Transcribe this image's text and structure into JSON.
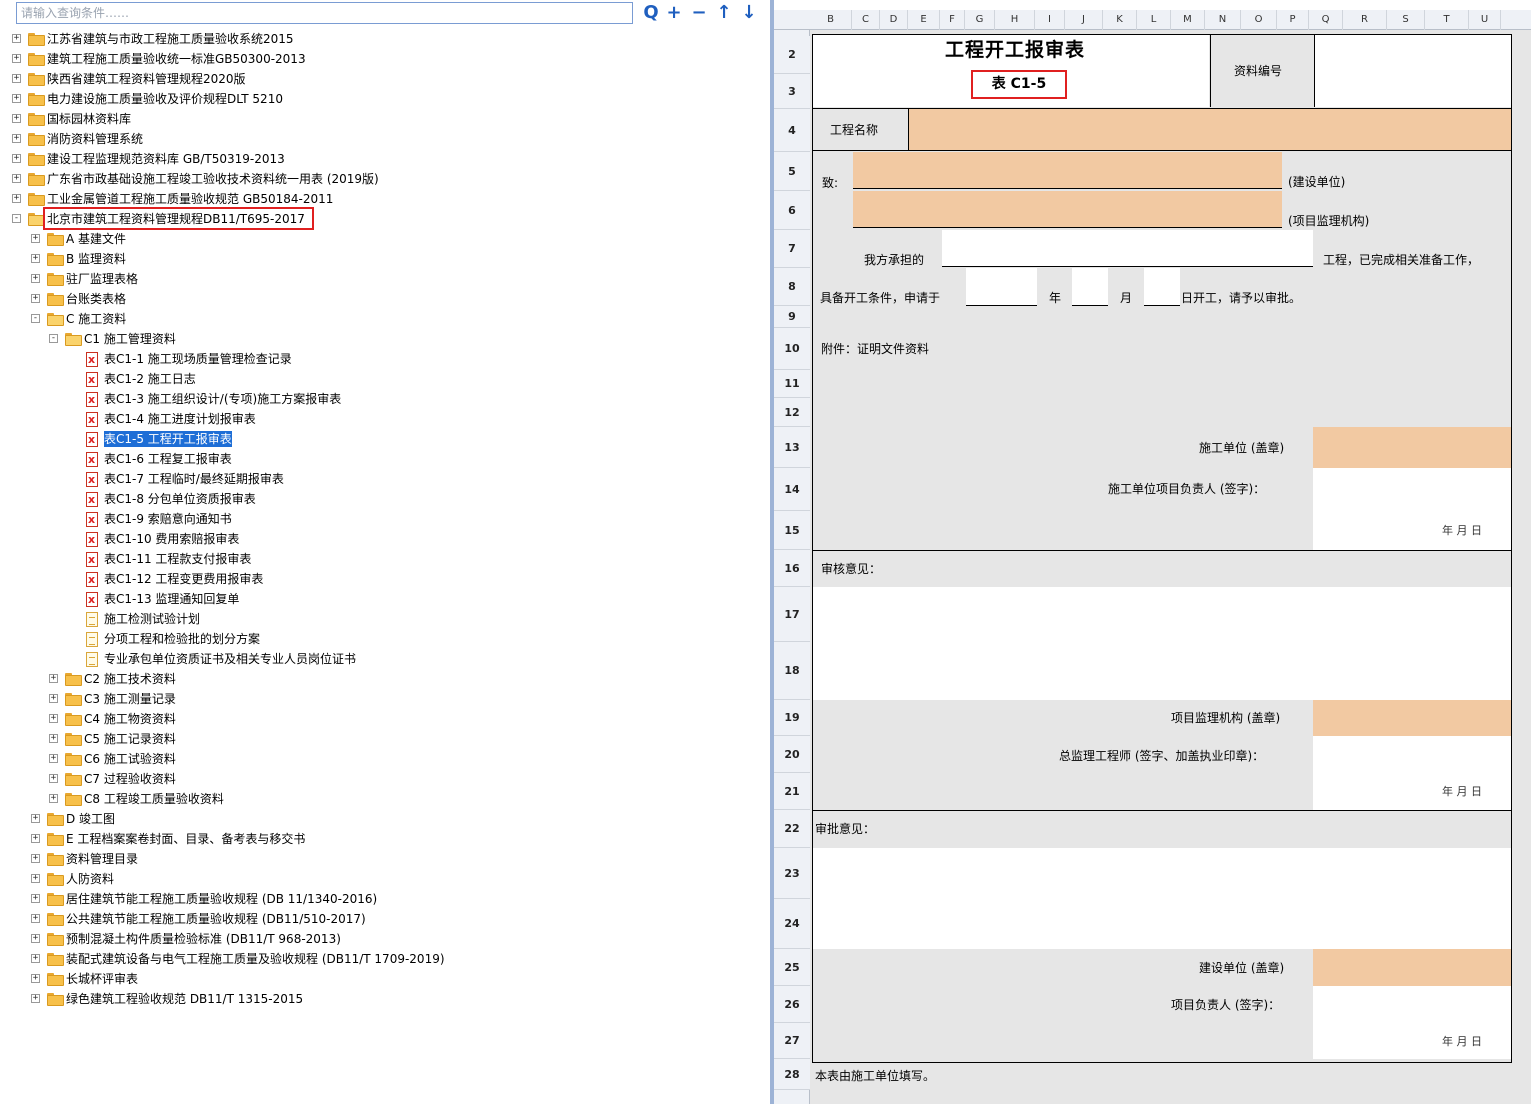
{
  "search": {
    "placeholder": "请输入查询条件……"
  },
  "toolbar": {
    "search_label": "Q",
    "add_label": "+",
    "remove_label": "−",
    "up_label": "↑",
    "down_label": "↓"
  },
  "tree": {
    "items": [
      {
        "label": "江苏省建筑与市政工程施工质量验收系统2015",
        "level": 0,
        "icon": "folder",
        "expanded": false
      },
      {
        "label": "建筑工程施工质量验收统一标准GB50300-2013",
        "level": 0,
        "icon": "folder",
        "expanded": false
      },
      {
        "label": "陕西省建筑工程资料管理规程2020版",
        "level": 0,
        "icon": "folder",
        "expanded": false
      },
      {
        "label": "电力建设施工质量验收及评价规程DLT 5210",
        "level": 0,
        "icon": "folder",
        "expanded": false
      },
      {
        "label": "国标园林资料库",
        "level": 0,
        "icon": "folder",
        "expanded": false
      },
      {
        "label": "消防资料管理系统",
        "level": 0,
        "icon": "folder",
        "expanded": false
      },
      {
        "label": "建设工程监理规范资料库 GB/T50319-2013",
        "level": 0,
        "icon": "folder",
        "expanded": false
      },
      {
        "label": "广东省市政基础设施工程竣工验收技术资料统一用表 (2019版)",
        "level": 0,
        "icon": "folder",
        "expanded": false
      },
      {
        "label": "工业金属管道工程施工质量验收规范 GB50184-2011",
        "level": 0,
        "icon": "folder",
        "expanded": false
      },
      {
        "label": "北京市建筑工程资料管理规程DB11/T695-2017",
        "level": 0,
        "icon": "folder-open",
        "expanded": true,
        "highlight": true
      },
      {
        "label": "A 基建文件",
        "level": 1,
        "icon": "folder",
        "expanded": false
      },
      {
        "label": "B 监理资料",
        "level": 1,
        "icon": "folder",
        "expanded": false
      },
      {
        "label": "驻厂监理表格",
        "level": 1,
        "icon": "folder",
        "expanded": false
      },
      {
        "label": "台账类表格",
        "level": 1,
        "icon": "folder",
        "expanded": false
      },
      {
        "label": "C 施工资料",
        "level": 1,
        "icon": "folder-open",
        "expanded": true
      },
      {
        "label": "C1 施工管理资料",
        "level": 2,
        "icon": "folder-open",
        "expanded": true
      },
      {
        "label": "表C1-1 施工现场质量管理检查记录",
        "level": 3,
        "icon": "xls"
      },
      {
        "label": "表C1-2 施工日志",
        "level": 3,
        "icon": "xls"
      },
      {
        "label": "表C1-3 施工组织设计/(专项)施工方案报审表",
        "level": 3,
        "icon": "xls"
      },
      {
        "label": "表C1-4 施工进度计划报审表",
        "level": 3,
        "icon": "xls"
      },
      {
        "label": "表C1-5 工程开工报审表",
        "level": 3,
        "icon": "xls",
        "selected": true
      },
      {
        "label": "表C1-6 工程复工报审表",
        "level": 3,
        "icon": "xls"
      },
      {
        "label": "表C1-7 工程临时/最终延期报审表",
        "level": 3,
        "icon": "xls"
      },
      {
        "label": "表C1-8 分包单位资质报审表",
        "level": 3,
        "icon": "xls"
      },
      {
        "label": "表C1-9 索赔意向通知书",
        "level": 3,
        "icon": "xls"
      },
      {
        "label": "表C1-10 费用索赔报审表",
        "level": 3,
        "icon": "xls"
      },
      {
        "label": "表C1-11 工程款支付报审表",
        "level": 3,
        "icon": "xls"
      },
      {
        "label": "表C1-12 工程变更费用报审表",
        "level": 3,
        "icon": "xls"
      },
      {
        "label": "表C1-13 监理通知回复单",
        "level": 3,
        "icon": "xls"
      },
      {
        "label": "施工检测试验计划",
        "level": 3,
        "icon": "doc"
      },
      {
        "label": "分项工程和检验批的划分方案",
        "level": 3,
        "icon": "doc"
      },
      {
        "label": "专业承包单位资质证书及相关专业人员岗位证书",
        "level": 3,
        "icon": "doc"
      },
      {
        "label": "C2 施工技术资料",
        "level": 2,
        "icon": "folder",
        "expanded": false
      },
      {
        "label": "C3 施工测量记录",
        "level": 2,
        "icon": "folder",
        "expanded": false
      },
      {
        "label": "C4 施工物资资料",
        "level": 2,
        "icon": "folder",
        "expanded": false
      },
      {
        "label": "C5 施工记录资料",
        "level": 2,
        "icon": "folder",
        "expanded": false
      },
      {
        "label": "C6 施工试验资料",
        "level": 2,
        "icon": "folder",
        "expanded": false
      },
      {
        "label": "C7 过程验收资料",
        "level": 2,
        "icon": "folder",
        "expanded": false
      },
      {
        "label": "C8 工程竣工质量验收资料",
        "level": 2,
        "icon": "folder",
        "expanded": false
      },
      {
        "label": "D 竣工图",
        "level": 1,
        "icon": "folder",
        "expanded": false
      },
      {
        "label": "E 工程档案案卷封面、目录、备考表与移交书",
        "level": 1,
        "icon": "folder",
        "expanded": false
      },
      {
        "label": "资料管理目录",
        "level": 1,
        "icon": "folder",
        "expanded": false
      },
      {
        "label": "人防资料",
        "level": 1,
        "icon": "folder",
        "expanded": false
      },
      {
        "label": "居住建筑节能工程施工质量验收规程 (DB 11/1340-2016)",
        "level": 1,
        "icon": "folder",
        "expanded": false
      },
      {
        "label": "公共建筑节能工程施工质量验收规程 (DB11/510-2017)",
        "level": 1,
        "icon": "folder",
        "expanded": false
      },
      {
        "label": "预制混凝土构件质量检验标准 (DB11/T 968-2013)",
        "level": 1,
        "icon": "folder",
        "expanded": false
      },
      {
        "label": "装配式建筑设备与电气工程施工质量及验收规程 (DB11/T 1709-2019)",
        "level": 1,
        "icon": "folder",
        "expanded": false
      },
      {
        "label": "长城杯评审表",
        "level": 1,
        "icon": "folder",
        "expanded": false
      },
      {
        "label": "绿色建筑工程验收规范 DB11/T 1315-2015",
        "level": 1,
        "icon": "folder",
        "expanded": false
      }
    ]
  },
  "sheet": {
    "columns": [
      "B",
      "C",
      "D",
      "E",
      "F",
      "G",
      "H",
      "I",
      "J",
      "K",
      "L",
      "M",
      "N",
      "O",
      "P",
      "Q",
      "R",
      "S",
      "T",
      "U"
    ],
    "rows": [
      "2",
      "3",
      "4",
      "5",
      "6",
      "7",
      "8",
      "9",
      "10",
      "11",
      "12",
      "13",
      "14",
      "15",
      "16",
      "17",
      "18",
      "19",
      "20",
      "21",
      "22",
      "23",
      "24",
      "25",
      "26",
      "27",
      "28"
    ],
    "title": "工程开工报审表",
    "table_no": "表 C1-5",
    "doc_no_label": "资料编号",
    "project_name_label": "工程名称",
    "to_label": "致:",
    "to_unit1": "(建设单位)",
    "to_unit2": "(项目监理机构)",
    "body1_prefix": "我方承担的",
    "body1_suffix": "工程，已完成相关准备工作，",
    "body2_prefix": "具备开工条件，申请于",
    "year": "年",
    "month": "月",
    "body2_suffix": "日开工，请予以审批。",
    "attachment": "附件：证明文件资料",
    "contractor_seal": "施工单位 (盖章)",
    "contractor_pm": "施工单位项目负责人 (签字)：",
    "date_ymd": "年    月    日",
    "review_label": "审核意见：",
    "supervisor_seal": "项目监理机构 (盖章)",
    "chief_engineer": "总监理工程师 (签字、加盖执业印章)：",
    "approval_label": "审批意见：",
    "owner_seal": "建设单位 (盖章)",
    "owner_pm": "项目负责人 (签字)：",
    "footnote": "本表由施工单位填写。"
  },
  "colors": {
    "accent": "#1e6ed6",
    "peach": "#f2c9a2",
    "highlight": "#e02020"
  }
}
